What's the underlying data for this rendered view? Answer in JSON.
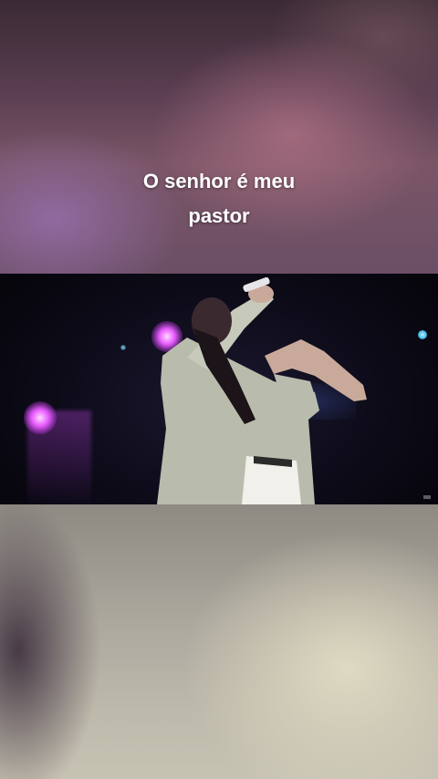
{
  "story": {
    "caption_lines": [
      "O senhor é meu",
      "pastor"
    ]
  },
  "video": {
    "description_icon": "stage-performer-video"
  },
  "colors": {
    "caption_text": "#ffffff",
    "stage_light": "#e85cff",
    "backdrop_top": "#5b3f52",
    "backdrop_bottom": "#aaa69c"
  }
}
